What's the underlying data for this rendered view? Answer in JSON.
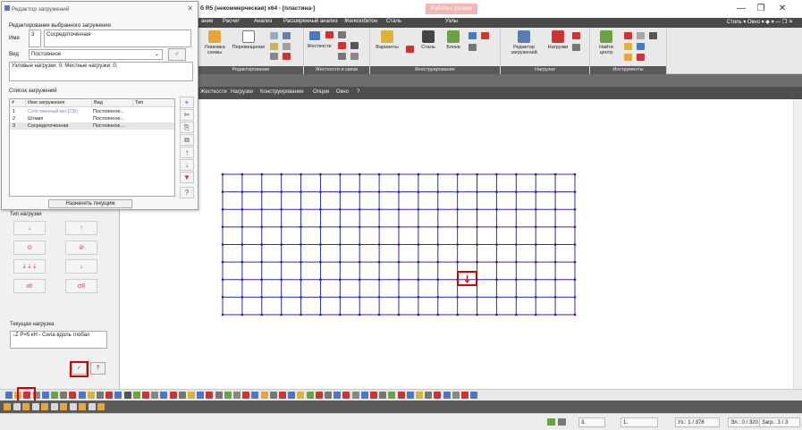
{
  "window": {
    "title": "б R5 (некоммерческая) x64 - [пластина-]",
    "badge": "Работа с узлами",
    "minimize": "—",
    "maximize": "❐",
    "close": "✕"
  },
  "menubar": {
    "items": [
      "ание",
      "Расчет",
      "Анализ",
      "Расширенный анализ",
      "Железобетон",
      "Сталь",
      "Узлы"
    ],
    "right": "Стиль  ▾  Окно  ▾  ◆  ▾  —  ❐  ✕"
  },
  "ribbon": {
    "groups": [
      {
        "label": "Редактирование",
        "buttons": [
          "Упаковка схемы",
          "Перемещение"
        ]
      },
      {
        "label": "Жесткости и связи",
        "buttons": [
          "Жесткости"
        ]
      },
      {
        "label": "Конструирование",
        "buttons": [
          "Варианты",
          "Сталь",
          "Блоки"
        ]
      },
      {
        "label": "Нагрузки",
        "buttons": [
          "Редактор загружений",
          "Нагрузки"
        ]
      },
      {
        "label": "Инструменты",
        "buttons": [
          "Найти центр"
        ]
      }
    ],
    "icon_names": [
      "package-icon",
      "move-icon",
      "stiffness-icon",
      "variants-icon",
      "steel-icon",
      "blocks-icon",
      "load-editor-icon",
      "loads-icon",
      "find-center-icon"
    ]
  },
  "menu2": {
    "items": [
      "Жесткости",
      "Нагрузки",
      "Конструирование",
      "Опции",
      "Окно",
      "?"
    ]
  },
  "dialog": {
    "title": "Редактор загружений",
    "close": "×",
    "section_edit": "Редактирование выбранного загружения",
    "name_label": "Имя",
    "name_number": "3",
    "name_value": "Сосредоточенная",
    "type_label": "Вид",
    "type_value": "Постоянное",
    "summary": "Узловые нагрузки: 0;  Местные нагрузки: 0;",
    "list_label": "Список загружений",
    "columns": [
      "#",
      "Имя загружения",
      "Вид",
      "Тип"
    ],
    "rows": [
      {
        "num": "1",
        "name": "Собственный вес(СВ)",
        "type": "Постоянное...",
        "kind": ""
      },
      {
        "num": "2",
        "name": "Штамп",
        "type": "Постоянное...",
        "kind": ""
      },
      {
        "num": "3",
        "name": "Сосредоточенная",
        "type": "Постоянное...",
        "kind": ""
      }
    ],
    "assign_button": "Назначить текущим",
    "side_buttons": [
      "+",
      "✂",
      "⎘",
      "⧉",
      "↑",
      "↓",
      "▼",
      "?"
    ]
  },
  "left_panel": {
    "load_type_label": "Тип нагрузки",
    "current_load_label": "Текущая нагрузка",
    "current_load_value": "↓Z  P=5 кН - Сила вдоль глобал",
    "ok": "✓",
    "help": "?",
    "load_icons": [
      "↓",
      "↑",
      "⊙",
      "⊘",
      "⇣⇣⇣",
      "↓",
      "σI",
      "σII"
    ]
  },
  "grid": {
    "cols": 18,
    "rows": 8
  },
  "statusbar": {
    "field1": "3.",
    "field2": "1.",
    "nodes": "Уз.: 1 / 378",
    "elements": "Эл.: 0 / 320",
    "loadcase": "Загр.: 3 / 3"
  }
}
